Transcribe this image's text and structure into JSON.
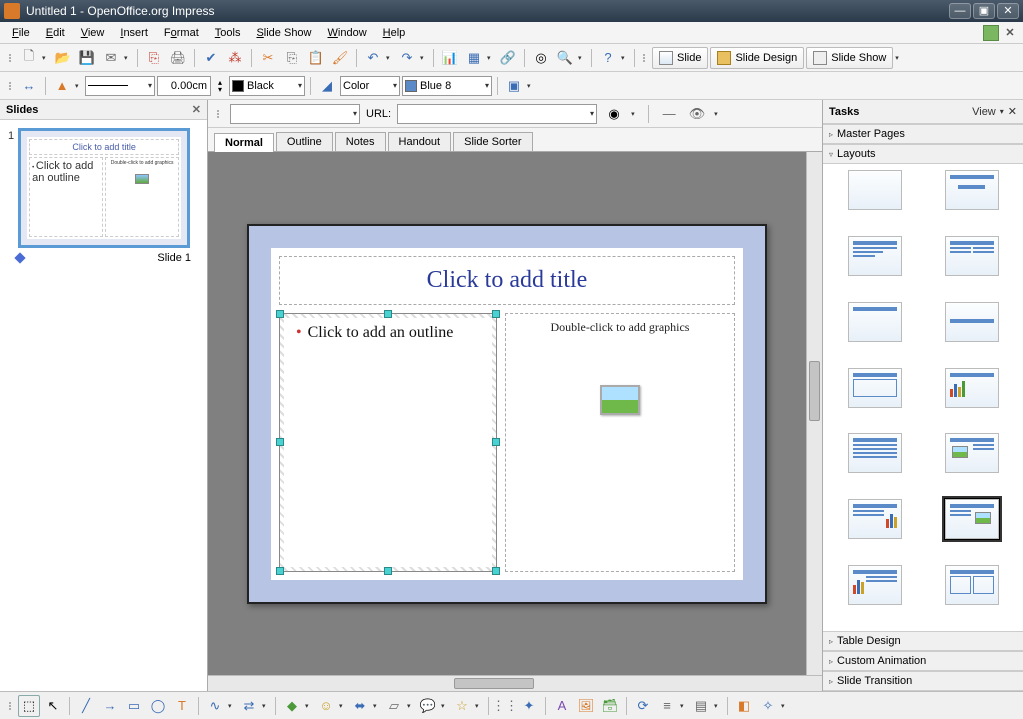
{
  "titlebar": {
    "title": "Untitled 1 - OpenOffice.org Impress"
  },
  "menubar": {
    "items": [
      {
        "label": "File",
        "key": "F"
      },
      {
        "label": "Edit",
        "key": "E"
      },
      {
        "label": "View",
        "key": "V"
      },
      {
        "label": "Insert",
        "key": "I"
      },
      {
        "label": "Format",
        "key": "o"
      },
      {
        "label": "Tools",
        "key": "T"
      },
      {
        "label": "Slide Show",
        "key": "S"
      },
      {
        "label": "Window",
        "key": "W"
      },
      {
        "label": "Help",
        "key": "H"
      }
    ]
  },
  "toolbar_main": {
    "slide_btn": "Slide",
    "slide_design_btn": "Slide Design",
    "slide_show_btn": "Slide Show"
  },
  "toolbar_line": {
    "width_value": "0.00cm",
    "color_label": "Black",
    "fill_mode": "Color",
    "fill_color": "Blue 8"
  },
  "url_bar": {
    "label": "URL:",
    "value": ""
  },
  "slides_panel": {
    "title": "Slides",
    "slide_number": "1",
    "thumb_title": "Click to add title",
    "thumb_outline": "Click to add an outline",
    "thumb_graphic": "Double-click to add graphics",
    "status_label": "Slide 1"
  },
  "view_tabs": [
    "Normal",
    "Outline",
    "Notes",
    "Handout",
    "Slide Sorter"
  ],
  "slide_canvas": {
    "title_placeholder": "Click to add title",
    "outline_placeholder": "Click to add an outline",
    "graphic_placeholder": "Double-click to add graphics"
  },
  "tasks_panel": {
    "title": "Tasks",
    "view_label": "View",
    "sections": {
      "master_pages": "Master Pages",
      "layouts": "Layouts",
      "table_design": "Table Design",
      "custom_animation": "Custom Animation",
      "slide_transition": "Slide Transition"
    }
  },
  "colors": {
    "black": "#000000",
    "blue8": "#5a8ac8"
  }
}
